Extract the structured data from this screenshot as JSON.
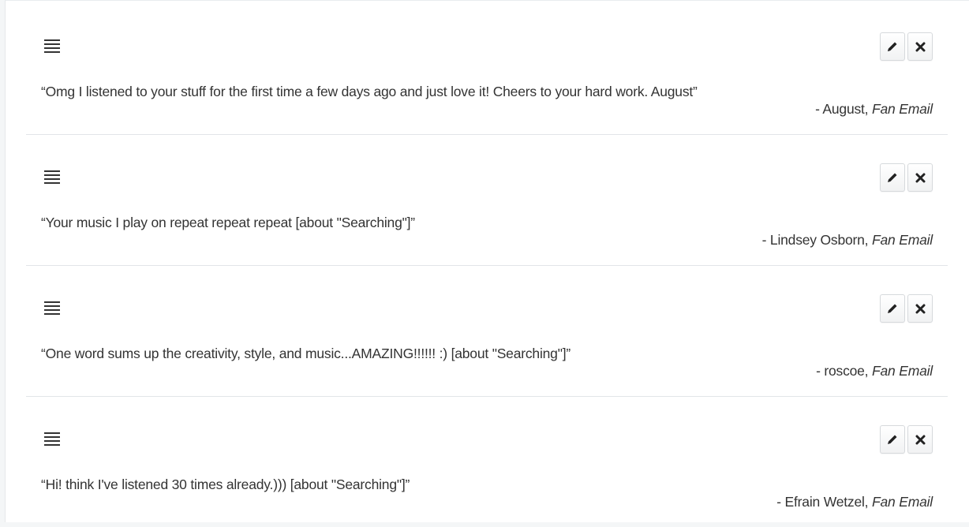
{
  "testimonials": [
    {
      "quote": "“Omg I listened to your stuff for the first time a few days ago and just love it! Cheers to your hard work. August”",
      "author": "- August, ",
      "source": "Fan Email"
    },
    {
      "quote": "“Your music I play on repeat repeat repeat [about \"Searching\"]”",
      "author": "- Lindsey Osborn, ",
      "source": "Fan Email"
    },
    {
      "quote": "“One word sums up the creativity, style, and music...AMAZING!!!!!! :) [about \"Searching\"]”",
      "author": "- roscoe, ",
      "source": "Fan Email"
    },
    {
      "quote": "“Hi! think I've listened 30 times already.))) [about \"Searching\"]”",
      "author": "- Efrain Wetzel, ",
      "source": "Fan Email"
    }
  ],
  "icons": {
    "drag": "drag-handle-icon",
    "edit": "pencil-icon",
    "delete": "close-icon"
  }
}
